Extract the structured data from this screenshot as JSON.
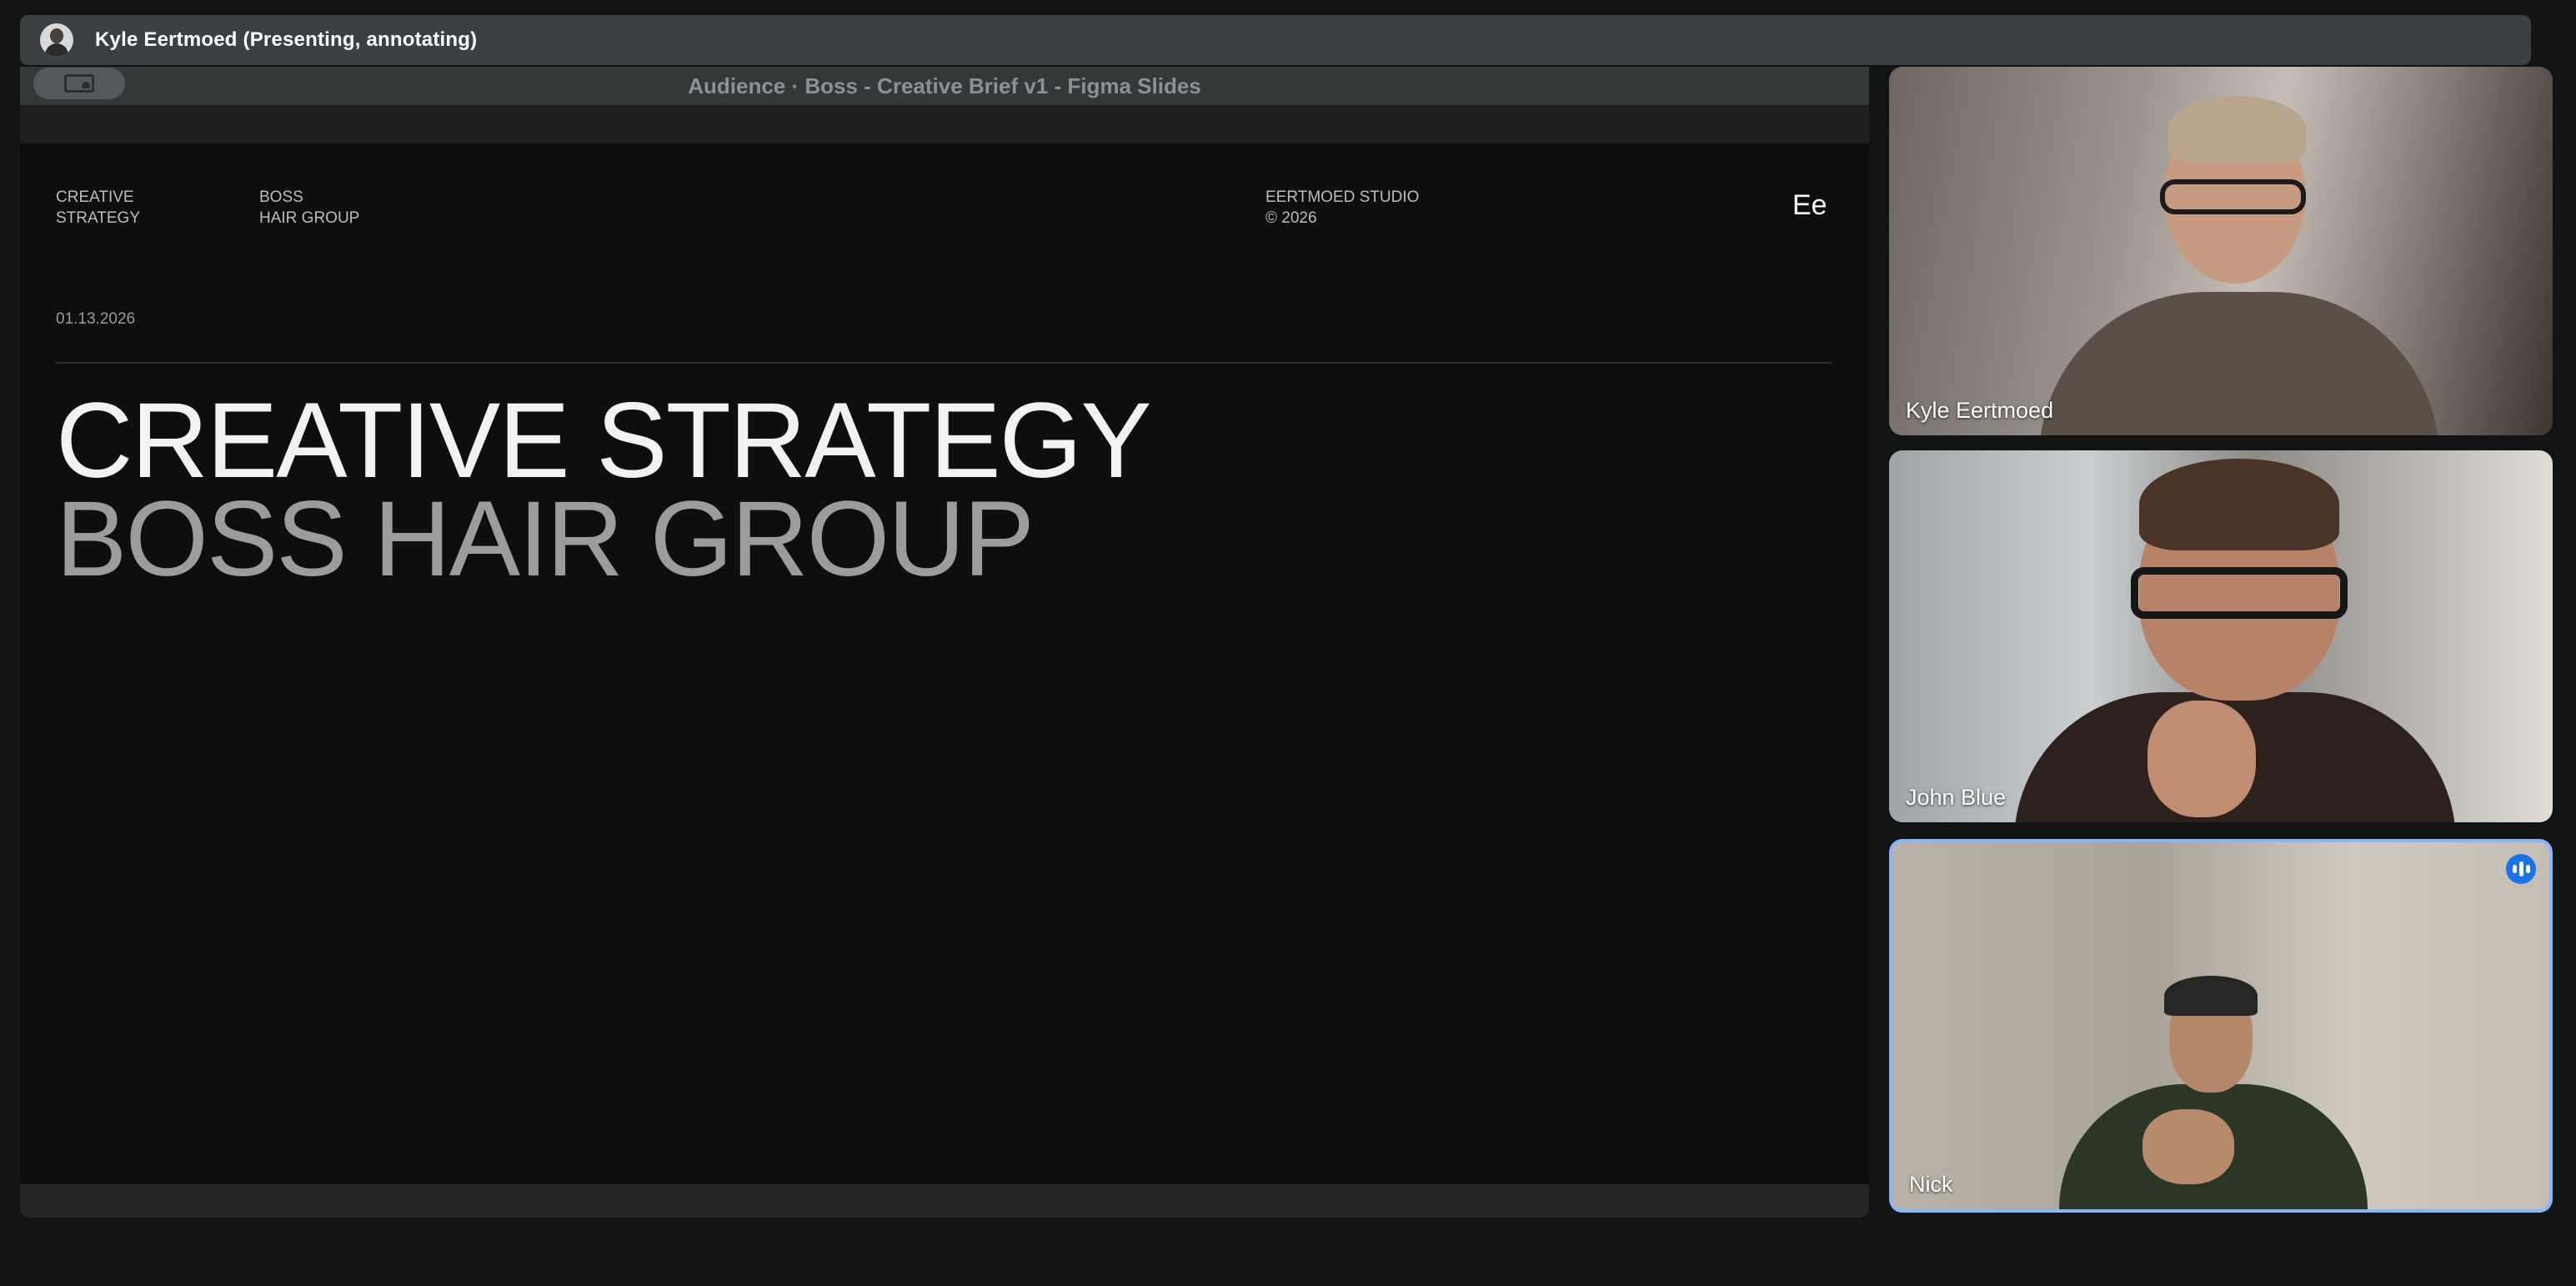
{
  "presenter": {
    "label": "Kyle Eertmoed (Presenting, annotating)"
  },
  "share": {
    "window_title": "Audience · Boss - Creative Brief v1 - Figma Slides",
    "toggle_icon": "presentation-toggle-icon"
  },
  "slide": {
    "meta_left_1": [
      "CREATIVE",
      "STRATEGY"
    ],
    "meta_left_2": [
      "BOSS",
      "HAIR GROUP"
    ],
    "meta_right": [
      "EERTMOED STUDIO",
      "© 2026"
    ],
    "logo": "Ee",
    "date": "01.13.2026",
    "headline_line1": "CREATIVE STRATEGY",
    "headline_line2": "BOSS HAIR GROUP"
  },
  "participants": [
    {
      "name": "Kyle Eertmoed",
      "speaking": false
    },
    {
      "name": "John Blue",
      "speaking": false
    },
    {
      "name": "Nick",
      "speaking": true
    }
  ],
  "colors": {
    "background": "#121414",
    "slide_background": "#0e0e0f",
    "headline_primary": "#f2f2f2",
    "headline_secondary": "#9c9c9c",
    "active_speaker_border": "#8ab4f8",
    "speaking_indicator": "#1a73e8"
  }
}
